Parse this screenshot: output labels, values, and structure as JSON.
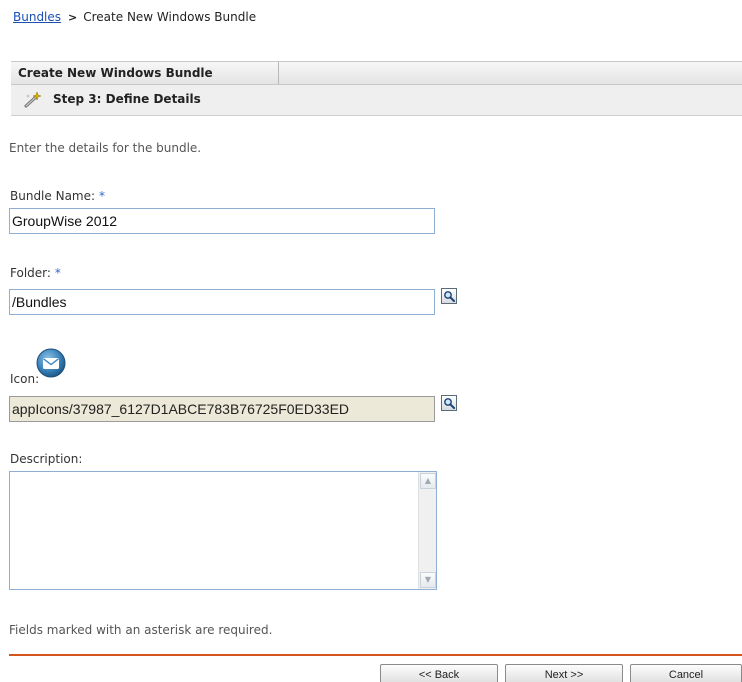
{
  "breadcrumb": {
    "link": "Bundles",
    "separator": ">",
    "current": "Create New Windows Bundle"
  },
  "wizard": {
    "tab_label": "Create New Windows Bundle",
    "step_title": "Step 3: Define Details",
    "step_icon": "magic-wand-icon"
  },
  "intro_text": "Enter the details for the bundle.",
  "fields": {
    "bundle_name": {
      "label": "Bundle Name:",
      "required_mark": "*",
      "value": "GroupWise 2012"
    },
    "folder": {
      "label": "Folder:",
      "required_mark": "*",
      "value": "/Bundles",
      "browse_icon": "magnifier-icon"
    },
    "icon": {
      "label": "Icon:",
      "preview_icon": "envelope-icon",
      "value": "appIcons/37987_6127D1ABCE783B76725F0ED33ED",
      "browse_icon": "magnifier-icon"
    },
    "description": {
      "label": "Description:",
      "value": ""
    }
  },
  "footnote": "Fields marked with an asterisk are required.",
  "buttons": {
    "back": "<< Back",
    "next": "Next >>",
    "cancel": "Cancel"
  },
  "colors": {
    "link": "#1a4fb4",
    "asterisk": "#3366cc",
    "divider": "#d4541c",
    "input_border": "#8eb0d4"
  }
}
